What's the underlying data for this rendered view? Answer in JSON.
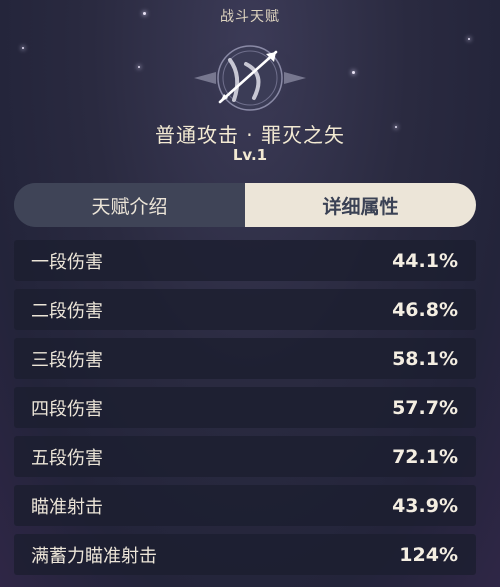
{
  "header": {
    "title": "战斗天赋"
  },
  "skill": {
    "name": "普通攻击 · 罪灭之矢",
    "level": "Lv.1",
    "icon": "bow-arrow-emblem-icon"
  },
  "tabs": [
    {
      "label": "天赋介绍",
      "active": false
    },
    {
      "label": "详细属性",
      "active": true
    }
  ],
  "stats": [
    {
      "label": "一段伤害",
      "value": "44.1%"
    },
    {
      "label": "二段伤害",
      "value": "46.8%"
    },
    {
      "label": "三段伤害",
      "value": "58.1%"
    },
    {
      "label": "四段伤害",
      "value": "57.7%"
    },
    {
      "label": "五段伤害",
      "value": "72.1%"
    },
    {
      "label": "瞄准射击",
      "value": "43.9%"
    },
    {
      "label": "满蓄力瞄准射击",
      "value": "124%"
    }
  ],
  "colors": {
    "text": "#ece5d8",
    "active_tab_bg": "#ece5d8",
    "active_tab_text": "#3b4255",
    "row_bg": "#1c1e30"
  }
}
